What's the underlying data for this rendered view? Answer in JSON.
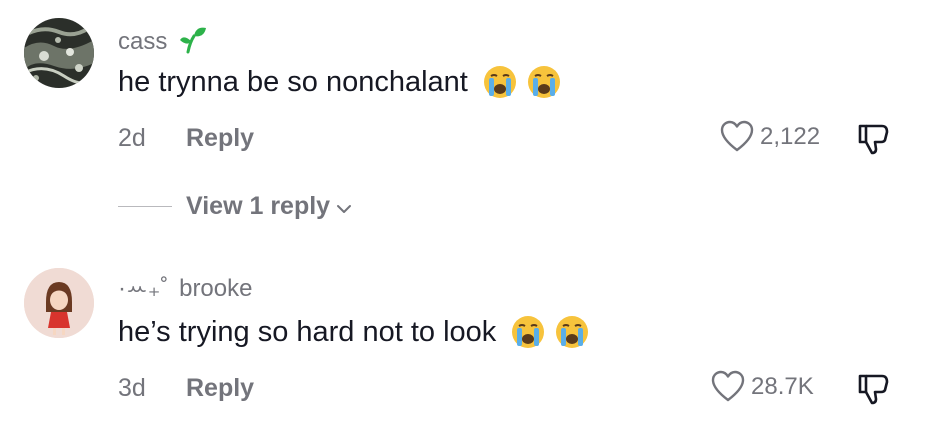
{
  "comments": [
    {
      "username": "cass",
      "username_icon": "seedling-icon",
      "text": "he trynna be so nonchalant",
      "emojis": [
        "loudly-crying-face-icon",
        "loudly-crying-face-icon"
      ],
      "age": "2d",
      "reply_label": "Reply",
      "like_count": "2,122"
    },
    {
      "username_prefix": "·ꕀ₊˚",
      "username": "brooke",
      "text": "he’s trying so hard not to look",
      "emojis": [
        "loudly-crying-face-icon",
        "loudly-crying-face-icon"
      ],
      "age": "3d",
      "reply_label": "Reply",
      "like_count": "28.7K"
    }
  ],
  "view_replies_label": "View 1 reply",
  "colors": {
    "text_primary": "#161823",
    "text_secondary": "#73747b",
    "seedling": "#2db24a",
    "emoji_face": "#f7c33c",
    "emoji_tear": "#5aaee8"
  }
}
